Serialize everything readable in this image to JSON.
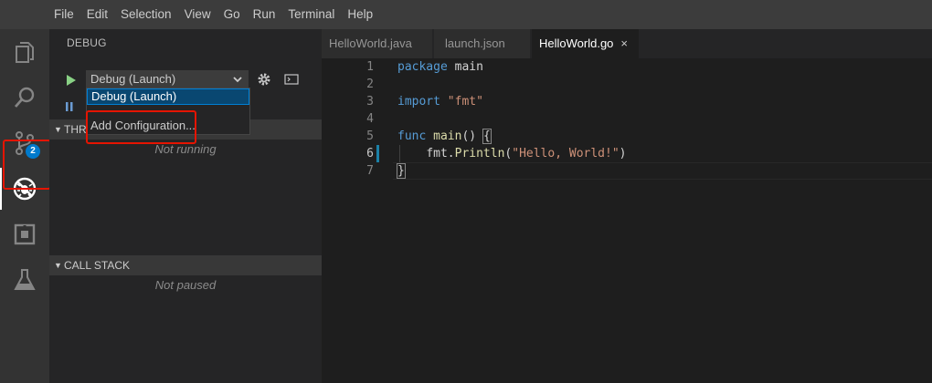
{
  "menu": [
    "File",
    "Edit",
    "Selection",
    "View",
    "Go",
    "Run",
    "Terminal",
    "Help"
  ],
  "activity": {
    "scm_badge": "2"
  },
  "sidebar": {
    "title": "DEBUG",
    "select_value": "Debug (Launch)",
    "dropdown_options": [
      "Debug (Launch)",
      "Add Configuration..."
    ],
    "threads_header": "THREADS",
    "threads_empty": "Not running",
    "callstack_header": "CALL STACK",
    "callstack_empty": "Not paused"
  },
  "tabs": [
    {
      "label": "HelloWorld.java",
      "active": false
    },
    {
      "label": "launch.json",
      "active": false
    },
    {
      "label": "HelloWorld.go",
      "active": true
    }
  ],
  "tab_close_glyph": "×",
  "editor": {
    "line_numbers": [
      "1",
      "2",
      "3",
      "4",
      "5",
      "6",
      "7"
    ],
    "code": {
      "l1_kw": "package",
      "l1_rest": " main",
      "l3_kw": "import",
      "l3_str": "\"fmt\"",
      "l5_kw": "func",
      "l5_fn": "main",
      "l5_paren": "() ",
      "l5_brace": "{",
      "l6_indent": "    ",
      "l6_pkg": "fmt.",
      "l6_fn": "Println",
      "l6_open": "(",
      "l6_str": "\"Hello, World!\"",
      "l6_close": ")",
      "l7_brace": "}"
    }
  },
  "colors": {
    "accent": "#007acc",
    "highlight_box": "#e51400"
  }
}
